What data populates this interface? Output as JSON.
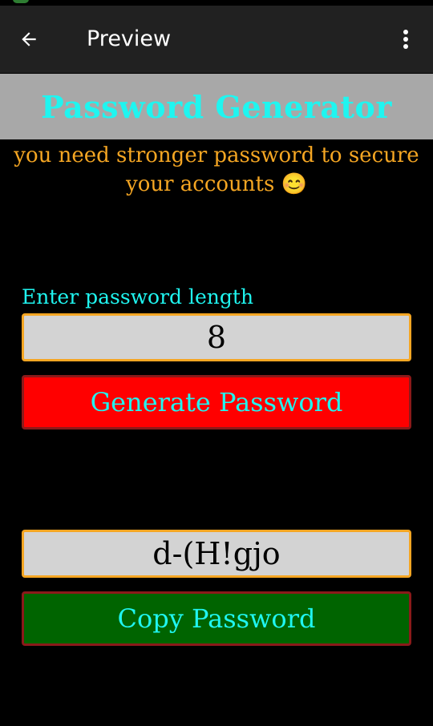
{
  "app_bar": {
    "title": "Preview",
    "back_icon": "arrow-left-icon",
    "menu_icon": "more-vert-icon"
  },
  "header": {
    "title": "Password Generator"
  },
  "subtitle": "you need stronger password to secure your accounts 😊",
  "length": {
    "label": "Enter password length",
    "value": "8"
  },
  "generate_button": "Generate Password",
  "password": {
    "value": "d-(H!gjo"
  },
  "copy_button": "Copy Password",
  "colors": {
    "cyan_text": "#1ff5f0",
    "orange_text": "#f5a623",
    "generate_bg": "#ff0000",
    "copy_bg": "#006400",
    "field_bg": "#d3d3d3",
    "banner_bg": "#a8a8a8",
    "appbar_bg": "#212121"
  }
}
